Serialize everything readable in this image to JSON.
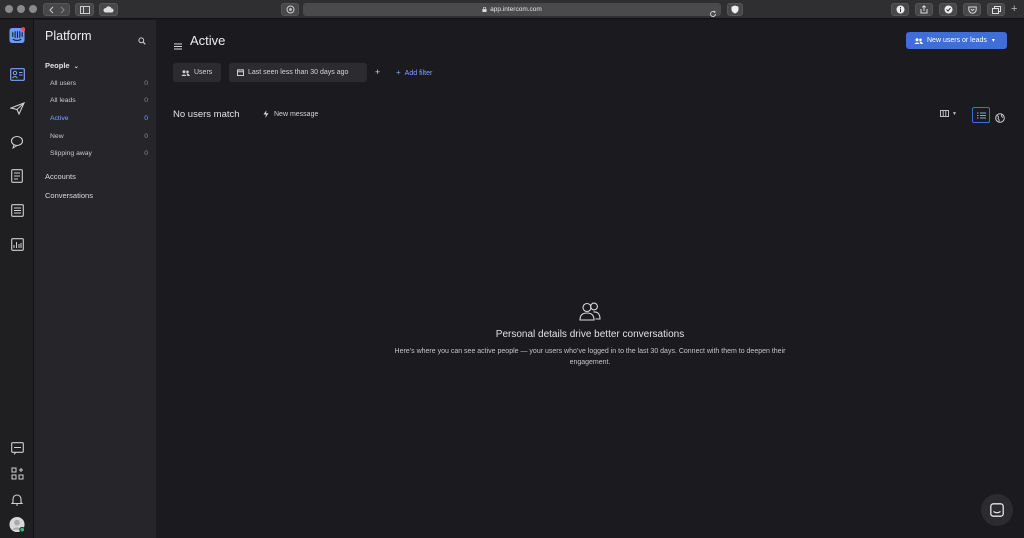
{
  "browser": {
    "url": "app.intercom.com"
  },
  "rail": {
    "icons": [
      "intercom-logo-icon",
      "contacts-icon",
      "outbound-icon",
      "inbox-icon",
      "articles-icon",
      "operator-icon",
      "reports-icon",
      "chat-icon",
      "apps-icon",
      "notifications-icon",
      "user-avatar"
    ]
  },
  "sidebar": {
    "title": "Platform",
    "people_section": "People",
    "items": [
      {
        "label": "All users",
        "count": "0"
      },
      {
        "label": "All leads",
        "count": "0"
      },
      {
        "label": "Active",
        "count": "0"
      },
      {
        "label": "New",
        "count": "0"
      },
      {
        "label": "Slipping away",
        "count": "0"
      }
    ],
    "accounts": "Accounts",
    "conversations": "Conversations"
  },
  "main": {
    "title": "Active",
    "primary_button": "New users or leads",
    "filters": {
      "users": "Users",
      "last_seen": "Last seen less than 30 days ago",
      "plus": "+",
      "add_filter": "Add filter"
    },
    "no_match": "No users match",
    "new_message": "New message",
    "empty_state": {
      "title": "Personal details drive better conversations",
      "text": "Here’s where you can see active people — your users who’ve logged in to the last 30 days. Connect with them to deepen their engagement."
    }
  },
  "colors": {
    "accent": "#3f6ed8",
    "link": "#7da4ff",
    "background": "#1b1b1f",
    "sidebar": "#26262a"
  }
}
